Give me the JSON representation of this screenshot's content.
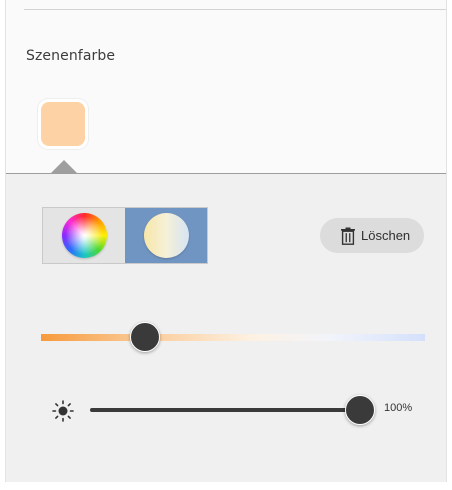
{
  "scene": {
    "title": "Szenenfarbe",
    "swatch_color": "#fdd3a6"
  },
  "mode": {
    "options": [
      "rgb-color-wheel",
      "white-tunable"
    ],
    "selected": "white-tunable",
    "selected_color": "#7195c2"
  },
  "delete_button": {
    "label": "Löschen",
    "icon": "trash-icon"
  },
  "color_temperature": {
    "value_fraction": 0.27,
    "gradient": [
      "#f79a3c",
      "#fac893",
      "#fdf1e2",
      "#f2f4fb",
      "#d4e0fb"
    ]
  },
  "brightness": {
    "icon": "sun-icon",
    "value_percent": 100,
    "label": "100%"
  }
}
